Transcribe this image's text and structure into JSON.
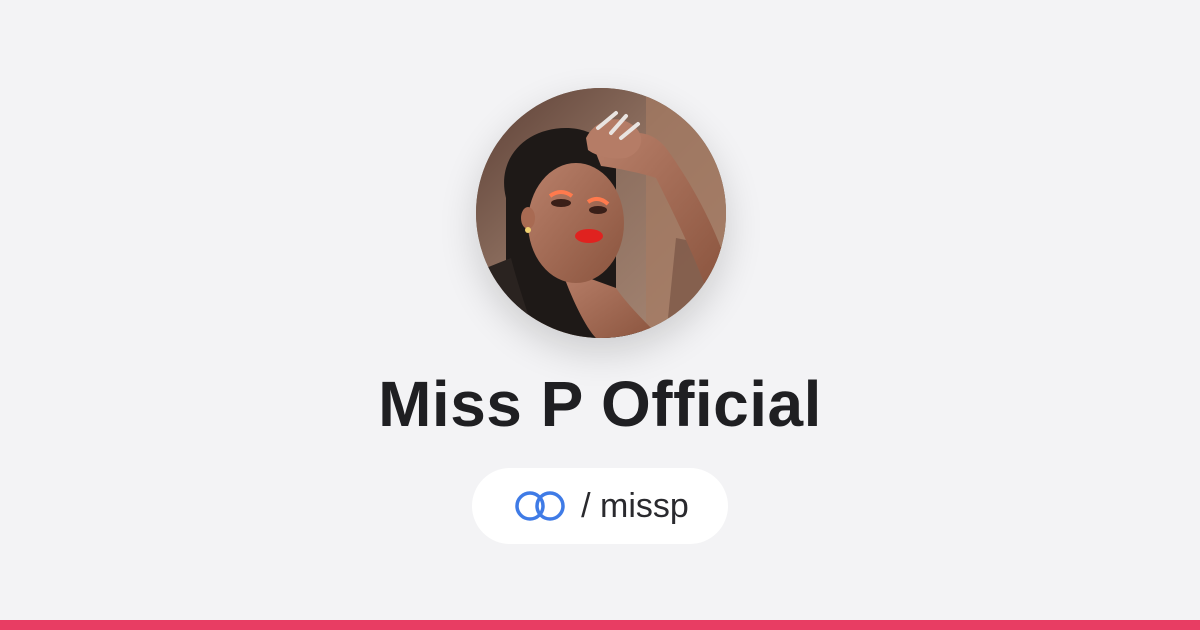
{
  "profile": {
    "name": "Miss P Official",
    "handle": "/ missp",
    "avatar_alt": "Miss P Official profile photo"
  },
  "brand": {
    "logo_icon": "linked-rings-icon",
    "logo_color": "#3f7be6",
    "accent_bar_color": "#e83d63"
  },
  "colors": {
    "background": "#f3f3f5",
    "pill_background": "#ffffff",
    "text": "#1f1f22"
  }
}
